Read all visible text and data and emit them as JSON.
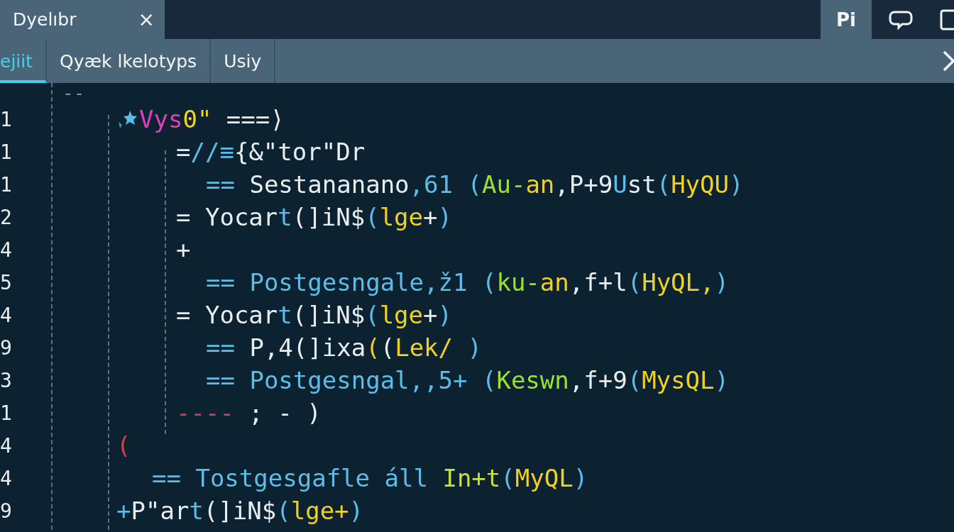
{
  "window_tab": {
    "title": "Dyelıbr",
    "close": "×"
  },
  "toolbar": {
    "badge": "Pi"
  },
  "tabs": [
    {
      "label": "ejiit",
      "selected": true
    },
    {
      "label": "Qyæk lkelotyps",
      "selected": false
    },
    {
      "label": "Usiy",
      "selected": false
    }
  ],
  "editor": {
    "lines": [
      {
        "kind": "top",
        "tokens": [
          {
            "text": "--",
            "color": "#7f8c99"
          }
        ]
      },
      {
        "number": "1",
        "kind": "header",
        "icon": true,
        "tokens": [
          {
            "text": "Vys",
            "color": "#e040c0"
          },
          {
            "text": "0\"",
            "color": "#f0d020"
          },
          {
            "text": " ===⟩",
            "color": "#e8eef0"
          }
        ]
      },
      {
        "number": "1",
        "kind": "body",
        "tokens": [
          {
            "text": "=",
            "color": "#e8eef0"
          },
          {
            "text": "//≡",
            "color": "#5bbde8"
          },
          {
            "text": "{&\"tor\"Dr",
            "color": "#e8eef0"
          }
        ]
      },
      {
        "number": "1",
        "kind": "entry",
        "tokens": [
          {
            "text": "==",
            "color": "#5bbde8"
          },
          {
            "text": " Sestananano",
            "color": "#e8eef0"
          },
          {
            "text": ",61 (",
            "color": "#5bbde8"
          },
          {
            "text": "Au-",
            "color": "#9be030"
          },
          {
            "text": "an",
            "color": "#f0d020"
          },
          {
            "text": ",P+9",
            "color": "#e8eef0"
          },
          {
            "text": "U",
            "color": "#5bbde8"
          },
          {
            "text": "st",
            "color": "#e8eef0"
          },
          {
            "text": "(",
            "color": "#5bbde8"
          },
          {
            "text": "HyQU",
            "color": "#f0d020"
          },
          {
            "text": ")",
            "color": "#5bbde8"
          }
        ]
      },
      {
        "number": "2",
        "kind": "body",
        "tokens": [
          {
            "text": "= Yocar",
            "color": "#e8eef0"
          },
          {
            "text": "t",
            "color": "#5bbde8"
          },
          {
            "text": "(]iN$",
            "color": "#e8eef0"
          },
          {
            "text": "(",
            "color": "#5bbde8"
          },
          {
            "text": "lge",
            "color": "#f0d020"
          },
          {
            "text": "+",
            "color": "#e8eef0"
          },
          {
            "text": ")",
            "color": "#5bbde8"
          }
        ]
      },
      {
        "number": "4",
        "kind": "body",
        "tokens": [
          {
            "text": "+",
            "color": "#e8eef0"
          }
        ]
      },
      {
        "number": "5",
        "kind": "entry",
        "tokens": [
          {
            "text": "== Postgesngale,ž1 (",
            "color": "#5bbde8"
          },
          {
            "text": "ku-",
            "color": "#9be030"
          },
          {
            "text": "an",
            "color": "#f0d020"
          },
          {
            "text": ",f+l",
            "color": "#e8eef0"
          },
          {
            "text": "(",
            "color": "#5bbde8"
          },
          {
            "text": "HyQL,",
            "color": "#f0d020"
          },
          {
            "text": ")",
            "color": "#5bbde8"
          }
        ]
      },
      {
        "number": "4",
        "kind": "body",
        "tokens": [
          {
            "text": "= Yocar",
            "color": "#e8eef0"
          },
          {
            "text": "t",
            "color": "#5bbde8"
          },
          {
            "text": "(]iN$",
            "color": "#e8eef0"
          },
          {
            "text": "(",
            "color": "#5bbde8"
          },
          {
            "text": "lge",
            "color": "#f0d020"
          },
          {
            "text": "+",
            "color": "#e8eef0"
          },
          {
            "text": ")",
            "color": "#5bbde8"
          }
        ]
      },
      {
        "number": "9",
        "kind": "entry",
        "tokens": [
          {
            "text": "==",
            "color": "#5bbde8"
          },
          {
            "text": " P,4(]ixa",
            "color": "#e8eef0"
          },
          {
            "text": "(",
            "color": "#f0d020"
          },
          {
            "text": "(",
            "color": "#e8eef0"
          },
          {
            "text": "Lek/",
            "color": "#f0d020"
          },
          {
            "text": " )",
            "color": "#5bbde8"
          }
        ]
      },
      {
        "number": "3",
        "kind": "entry",
        "tokens": [
          {
            "text": "== Postgesngal,,5+ (",
            "color": "#5bbde8"
          },
          {
            "text": "Keswn",
            "color": "#9be030"
          },
          {
            "text": ",f+9",
            "color": "#e8eef0"
          },
          {
            "text": "(",
            "color": "#5bbde8"
          },
          {
            "text": "MysQL",
            "color": "#f0d020"
          },
          {
            "text": ")",
            "color": "#5bbde8"
          }
        ]
      },
      {
        "number": "1",
        "kind": "body",
        "tokens": [
          {
            "text": "----",
            "color": "#d04050"
          },
          {
            "text": " ; - )",
            "color": "#e8eef0"
          }
        ]
      },
      {
        "number": "4",
        "kind": "header",
        "tokens": [
          {
            "text": "(",
            "color": "#d04050"
          }
        ]
      },
      {
        "number": "4",
        "kind": "item",
        "tokens": [
          {
            "text": "== Tostgesgafle áll ",
            "color": "#5bbde8"
          },
          {
            "text": "In+t",
            "color": "#c8e040"
          },
          {
            "text": "(",
            "color": "#5bbde8"
          },
          {
            "text": "MyQL",
            "color": "#f0d020"
          },
          {
            "text": ")",
            "color": "#5bbde8"
          }
        ]
      },
      {
        "number": "9",
        "kind": "header",
        "tokens": [
          {
            "text": "+",
            "color": "#5bbde8"
          },
          {
            "text": "P\"ar",
            "color": "#e8eef0"
          },
          {
            "text": "t",
            "color": "#5bbde8"
          },
          {
            "text": "(]iN$",
            "color": "#e8eef0"
          },
          {
            "text": "(",
            "color": "#5bbde8"
          },
          {
            "text": "lge+",
            "color": "#f0d020"
          },
          {
            "text": ")",
            "color": "#5bbde8"
          }
        ]
      }
    ]
  }
}
